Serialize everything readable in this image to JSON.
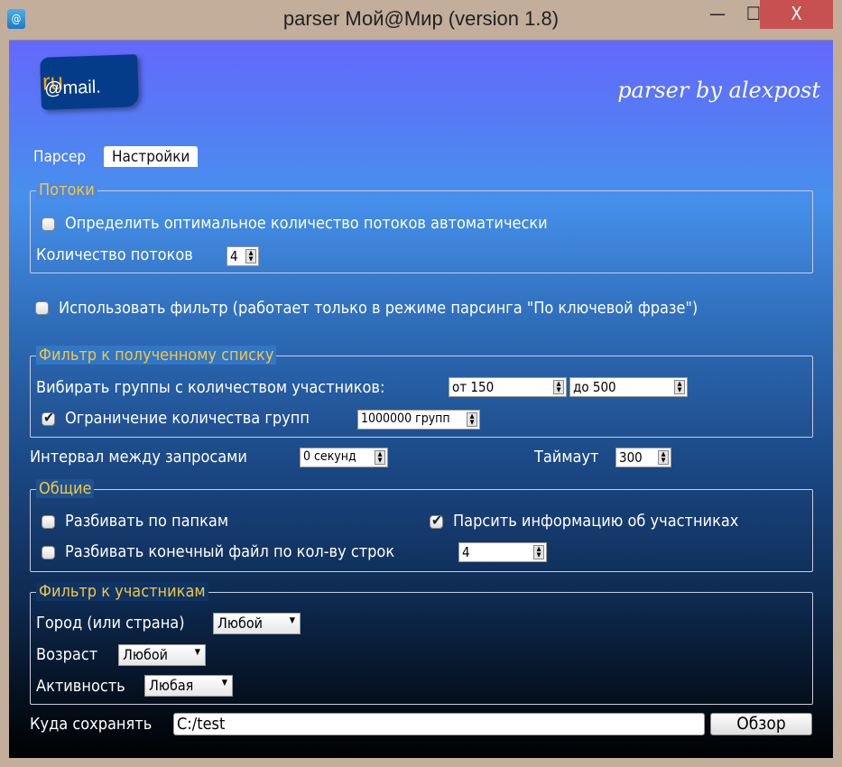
{
  "window": {
    "title": "parser Мой@Мир (version 1.8)",
    "icon": "@",
    "minimize": "—",
    "maximize": "☐",
    "close": "X"
  },
  "header": {
    "logo_text": "@mail.",
    "logo_ru": "ru",
    "signature": "parser by alexpost"
  },
  "tabs": [
    {
      "label": "Парсер"
    },
    {
      "label": "Настройки"
    }
  ],
  "threads": {
    "legend": "Потоки",
    "auto_label": "Определить оптимальное количество потоков автоматически",
    "auto_checked": false,
    "count_label": "Количество потоков",
    "count_value": "4"
  },
  "use_filter": {
    "label": "Использовать фильтр (работает только в режиме парсинга \"По ключевой фразе\")",
    "checked": false
  },
  "list_filter": {
    "legend": "Фильтр к полученному списку",
    "members_label": "Вибирать группы с количеством участников:",
    "from": "от 150",
    "to": "до 500",
    "limit_label": "Ограничение количества групп",
    "limit_checked": true,
    "limit_value": "1000000 групп"
  },
  "interval": {
    "label": "Интервал между запросами",
    "value": "0 секунд",
    "timeout_label": "Таймаут",
    "timeout_value": "300"
  },
  "general": {
    "legend": "Общие",
    "folders_label": "Разбивать по папкам",
    "folders_checked": false,
    "parse_info_label": "Парсить информацию об участниках",
    "parse_info_checked": true,
    "split_label": "Разбивать конечный файл по кол-ву строк",
    "split_checked": false,
    "split_value": "4"
  },
  "member_filter": {
    "legend": "Фильтр к участникам",
    "city_label": "Город (или страна)",
    "city_value": "Любой",
    "age_label": "Возраст",
    "age_value": "Любой",
    "activity_label": "Активность",
    "activity_value": "Любая"
  },
  "save": {
    "label": "Куда сохранять",
    "path": "C:/test",
    "browse": "Обзор"
  }
}
